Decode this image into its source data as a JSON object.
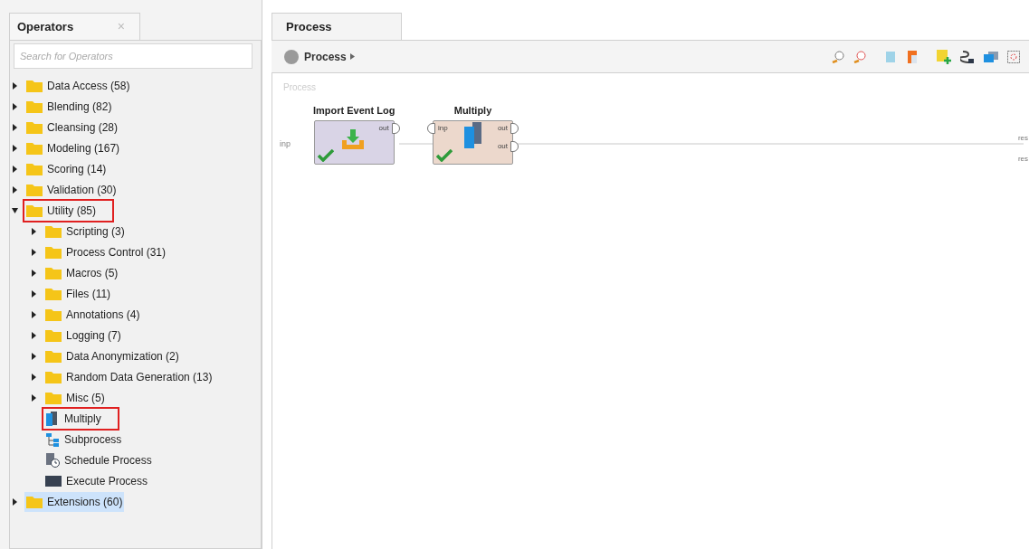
{
  "operators_panel": {
    "title": "Operators",
    "close": "×",
    "search": {
      "placeholder": "Search for Operators"
    },
    "tree": [
      {
        "kind": "folder",
        "label": "Data Access (58)",
        "expanded": false,
        "selected": false,
        "outlined": false
      },
      {
        "kind": "folder",
        "label": "Blending (82)",
        "expanded": false,
        "selected": false,
        "outlined": false
      },
      {
        "kind": "folder",
        "label": "Cleansing (28)",
        "expanded": false,
        "selected": false,
        "outlined": false
      },
      {
        "kind": "folder",
        "label": "Modeling (167)",
        "expanded": false,
        "selected": false,
        "outlined": false
      },
      {
        "kind": "folder",
        "label": "Scoring (14)",
        "expanded": false,
        "selected": false,
        "outlined": false
      },
      {
        "kind": "folder",
        "label": "Validation (30)",
        "expanded": false,
        "selected": false,
        "outlined": false
      },
      {
        "kind": "folder",
        "label": "Utility (85)",
        "expanded": true,
        "selected": false,
        "outlined": true,
        "children": [
          {
            "kind": "folder",
            "label": "Scripting (3)",
            "expanded": false,
            "selected": false,
            "outlined": false
          },
          {
            "kind": "folder",
            "label": "Process Control (31)",
            "expanded": false,
            "selected": false,
            "outlined": false
          },
          {
            "kind": "folder",
            "label": "Macros (5)",
            "expanded": false,
            "selected": false,
            "outlined": false
          },
          {
            "kind": "folder",
            "label": "Files (11)",
            "expanded": false,
            "selected": false,
            "outlined": false
          },
          {
            "kind": "folder",
            "label": "Annotations (4)",
            "expanded": false,
            "selected": false,
            "outlined": false
          },
          {
            "kind": "folder",
            "label": "Logging (7)",
            "expanded": false,
            "selected": false,
            "outlined": false
          },
          {
            "kind": "folder",
            "label": "Data Anonymization (2)",
            "expanded": false,
            "selected": false,
            "outlined": false
          },
          {
            "kind": "folder",
            "label": "Random Data Generation (13)",
            "expanded": false,
            "selected": false,
            "outlined": false
          },
          {
            "kind": "folder",
            "label": "Misc (5)",
            "expanded": false,
            "selected": false,
            "outlined": false
          },
          {
            "kind": "multiply",
            "label": "Multiply",
            "selected": false,
            "outlined": true
          },
          {
            "kind": "subprocess",
            "label": "Subprocess",
            "selected": false,
            "outlined": false
          },
          {
            "kind": "schedule",
            "label": "Schedule Process",
            "selected": false,
            "outlined": false
          },
          {
            "kind": "execute",
            "label": "Execute Process",
            "selected": false,
            "outlined": false
          }
        ]
      },
      {
        "kind": "folder",
        "label": "Extensions (60)",
        "expanded": false,
        "selected": true,
        "outlined": false
      }
    ]
  },
  "process_panel": {
    "tab": "Process",
    "breadcrumb": "Process",
    "canvas_label": "Process",
    "source_port": "inp",
    "sink_ports": [
      "res",
      "res"
    ],
    "nodes": [
      {
        "kind": "import",
        "title": "Import Event Log",
        "outputs": [
          "out"
        ],
        "ok": true
      },
      {
        "kind": "multiply",
        "title": "Multiply",
        "inputs": [
          "inp"
        ],
        "outputs": [
          "out",
          "out"
        ],
        "ok": true
      }
    ]
  }
}
